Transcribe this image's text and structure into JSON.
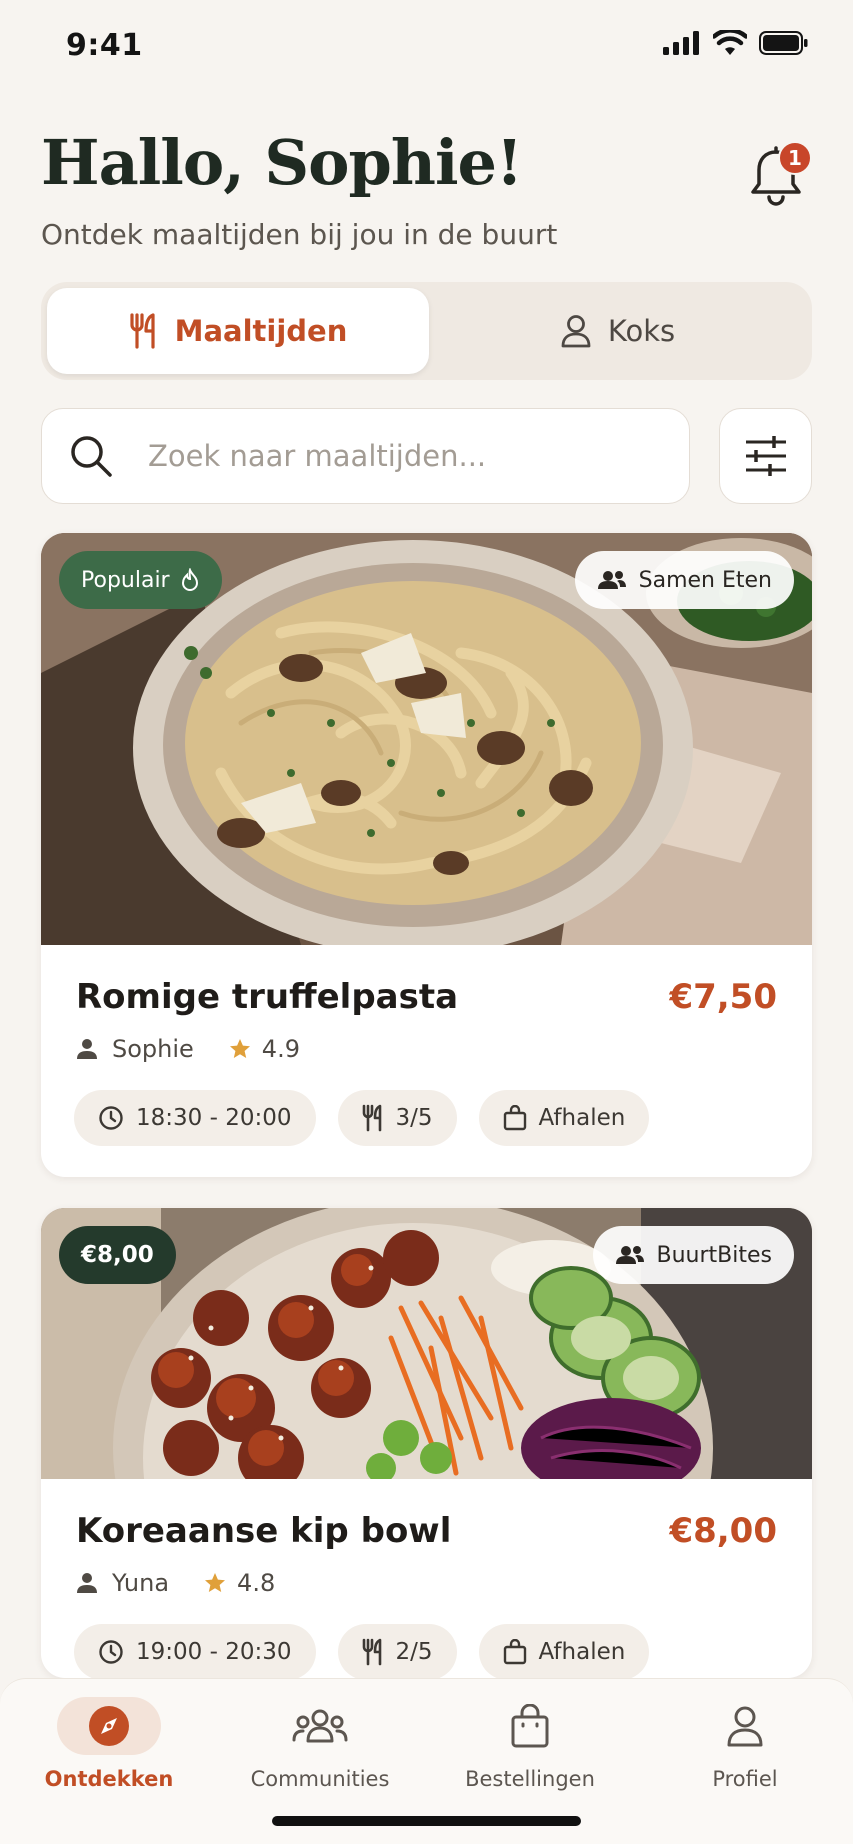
{
  "status_bar": {
    "time": "9:41"
  },
  "header": {
    "greeting": "Hallo, Sophie!",
    "subtitle": "Ontdek maaltijden bij jou in de buurt",
    "notification_count": "1"
  },
  "toggle": {
    "meals_label": "Maaltijden",
    "cooks_label": "Koks",
    "active": "Maaltijden"
  },
  "search": {
    "placeholder": "Zoek naar maaltijden..."
  },
  "meals": [
    {
      "badge_left": "Populair",
      "badge_right": "Samen Eten",
      "title": "Romige truffelpasta",
      "price": "€7,50",
      "cook": "Sophie",
      "rating": "4.9",
      "time": "18:30 - 20:00",
      "portions": "3/5",
      "delivery": "Afhalen"
    },
    {
      "badge_left": "€8,00",
      "badge_right": "BuurtBites",
      "title": "Koreaanse kip bowl",
      "price": "€8,00",
      "cook": "Yuna",
      "rating": "4.8",
      "time": "19:00 - 20:30",
      "portions": "2/5",
      "delivery": "Afhalen"
    }
  ],
  "bottom_nav": {
    "items": [
      {
        "label": "Ontdekken",
        "icon": "compass-icon",
        "active": true
      },
      {
        "label": "Communities",
        "icon": "people-icon",
        "active": false
      },
      {
        "label": "Bestellingen",
        "icon": "shopping-bag-icon",
        "active": false
      },
      {
        "label": "Profiel",
        "icon": "user-icon",
        "active": false
      }
    ]
  },
  "colors": {
    "accent": "#c14e25",
    "green_badge": "#3d6b48",
    "dark_badge": "#243a2c",
    "background": "#f7f4f0"
  }
}
